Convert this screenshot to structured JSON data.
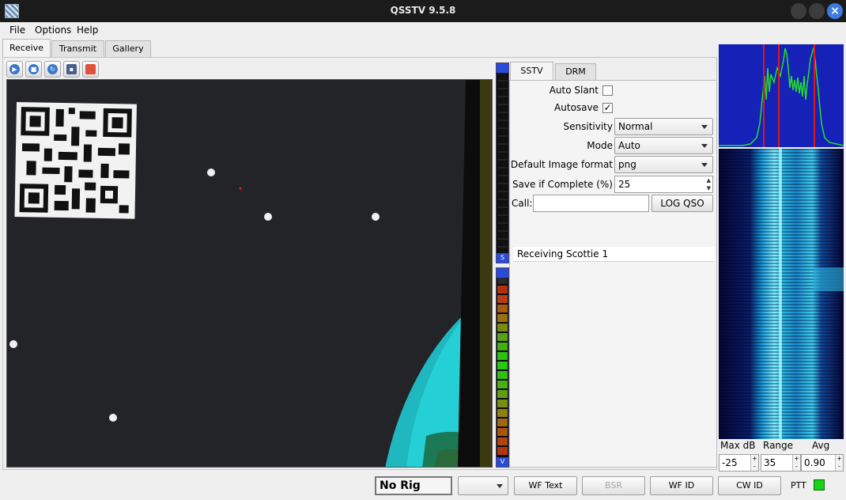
{
  "window": {
    "title": "QSSTV 9.5.8"
  },
  "menu": {
    "file": "File",
    "options": "Options",
    "help": "Help"
  },
  "tabs": {
    "receive": "Receive",
    "transmit": "Transmit",
    "gallery": "Gallery"
  },
  "settings_tabs": {
    "sstv": "SSTV",
    "drm": "DRM"
  },
  "settings": {
    "auto_slant_label": "Auto Slant",
    "auto_slant_checked": false,
    "autosave_label": "Autosave",
    "autosave_checked": true,
    "autosave_mark": "✓",
    "sensitivity_label": "Sensitivity",
    "sensitivity_value": "Normal",
    "mode_label": "Mode",
    "mode_value": "Auto",
    "image_format_label": "Default Image format",
    "image_format_value": "png",
    "save_complete_label": "Save if Complete (%)",
    "save_complete_value": "25",
    "call_label": "Call:",
    "call_value": "",
    "log_qso": "LOG QSO",
    "status_text": "Receiving Scottie 1"
  },
  "meters": {
    "top_cap": "S",
    "bottom_cap": "V"
  },
  "waterfall_controls": {
    "max_db_label": "Max dB",
    "max_db_value": "-25",
    "range_label": "Range",
    "range_value": "35",
    "avg_label": "Avg",
    "avg_value": "0.90",
    "up": "+",
    "down": "-"
  },
  "bottom": {
    "rig": "No Rig",
    "combo_value": "",
    "wf_text": "WF Text",
    "bsr": "BSR",
    "wf_id": "WF ID",
    "cw_id": "CW ID",
    "ptt": "PTT"
  },
  "colors": {
    "accent": "#3d7be0",
    "spectrum_bg": "#1621b8",
    "ptt_on": "#18d418"
  }
}
